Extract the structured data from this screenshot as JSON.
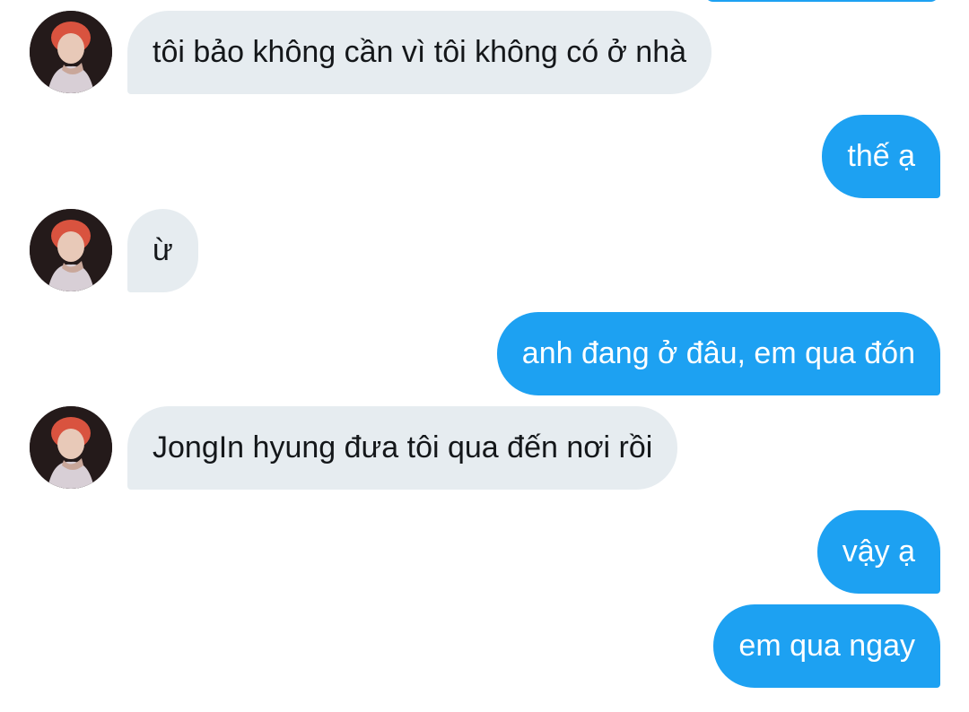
{
  "conversation": {
    "messages": [
      {
        "sender": "other",
        "text": "tôi bảo không cần vì tôi không có ở nhà"
      },
      {
        "sender": "me",
        "text": "thế ạ"
      },
      {
        "sender": "other",
        "text": "ừ"
      },
      {
        "sender": "me",
        "text": "anh đang ở đâu, em qua đón"
      },
      {
        "sender": "other",
        "text": "JongIn hyung đưa tôi qua đến nơi rồi"
      },
      {
        "sender": "me",
        "text": "vậy ạ"
      },
      {
        "sender": "me",
        "text": "em qua ngay"
      }
    ]
  },
  "colors": {
    "incoming_bubble": "#E6ECF0",
    "incoming_text": "#14171A",
    "outgoing_bubble": "#1DA1F2",
    "outgoing_text": "#FFFFFF",
    "background": "#FFFFFF"
  },
  "icons": {
    "avatar": "profile-photo-avatar"
  }
}
